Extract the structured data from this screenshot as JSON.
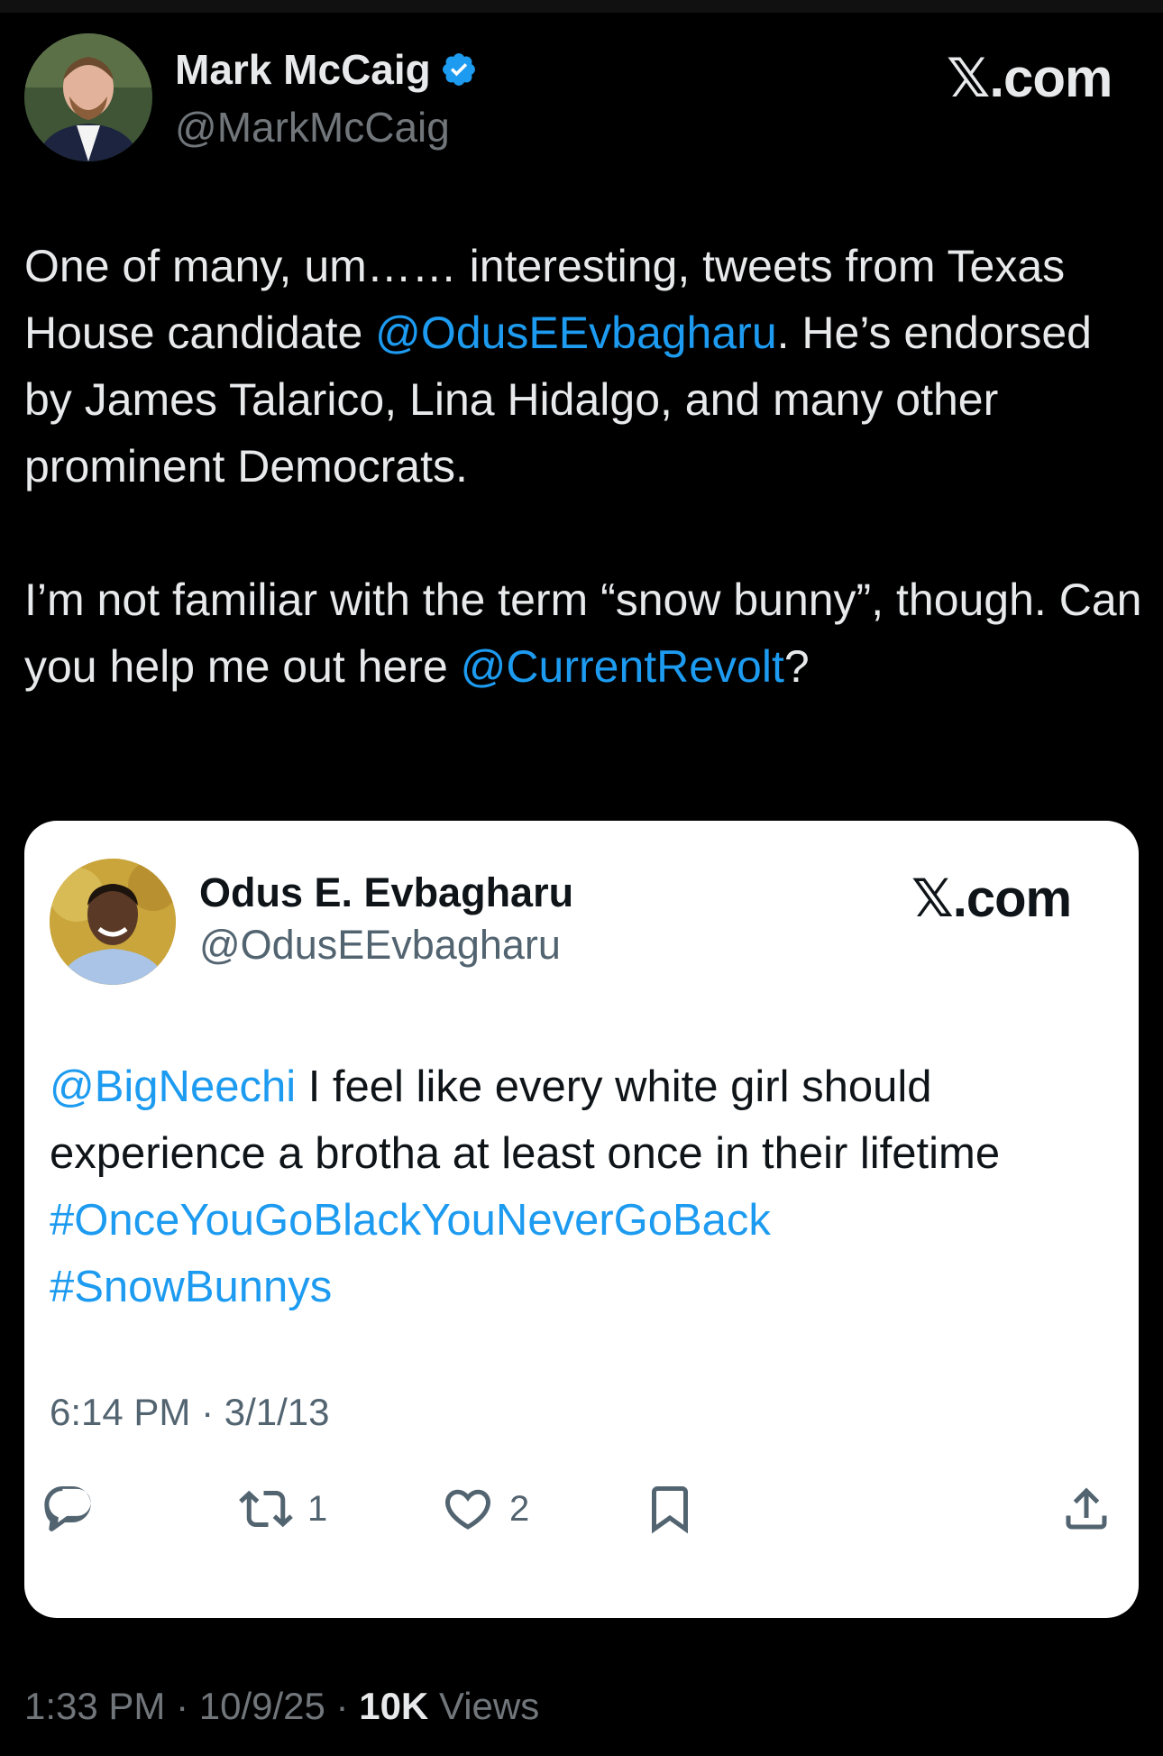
{
  "outer": {
    "name": "Mark McCaig",
    "handle": "@MarkMcCaig",
    "brand": "𝕏.com",
    "text": {
      "p1_a": "One of many, um…… interesting, tweets from Texas House candidate ",
      "p1_mention": "@OdusEEvbagharu",
      "p1_b": ". He’s endorsed by James Talarico, Lina Hidalgo, and many other prominent Democrats.",
      "p2_a": "I’m not familiar with the term “snow bunny”, though. Can you help me out here ",
      "p2_mention": "@CurrentRevolt",
      "p2_b": "?"
    },
    "time": "1:33 PM",
    "date": "10/9/25",
    "views_count": "10K",
    "views_label": "Views"
  },
  "quoted": {
    "name": "Odus E. Evbagharu",
    "handle": "@OdusEEvbagharu",
    "brand": "𝕏.com",
    "mention": "@BigNeechi",
    "text_a": " I feel like every white girl should",
    "text_b": "experience a brotha at least once in their lifetime",
    "hashtag1": "#OnceYouGoBlackYouNeverGoBack",
    "hashtag2": "#SnowBunnys",
    "time": "6:14 PM",
    "date": "3/1/13",
    "retweets": "1",
    "likes": "2"
  },
  "colors": {
    "background": "#000000",
    "link": "#1d9bf0",
    "verified": "#1d9bf0",
    "card": "#ffffff"
  },
  "icons": [
    "verified-badge-icon",
    "reply-icon",
    "retweet-icon",
    "like-icon",
    "bookmark-icon",
    "share-icon"
  ]
}
